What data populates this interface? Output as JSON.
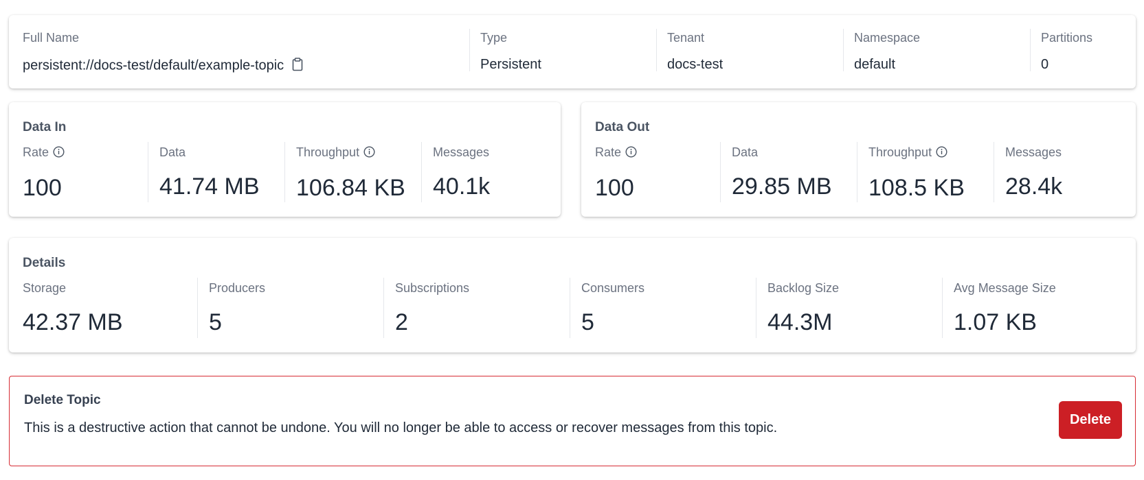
{
  "topic_info": {
    "full_name": {
      "label": "Full Name",
      "value": "persistent://docs-test/default/example-topic"
    },
    "type": {
      "label": "Type",
      "value": "Persistent"
    },
    "tenant": {
      "label": "Tenant",
      "value": "docs-test"
    },
    "namespace": {
      "label": "Namespace",
      "value": "default"
    },
    "partitions": {
      "label": "Partitions",
      "value": "0"
    }
  },
  "data_in": {
    "title": "Data In",
    "rate": {
      "label": "Rate",
      "value": "100"
    },
    "data": {
      "label": "Data",
      "value": "41.74 MB"
    },
    "throughput": {
      "label": "Throughput",
      "value": "106.84 KB"
    },
    "messages": {
      "label": "Messages",
      "value": "40.1k"
    }
  },
  "data_out": {
    "title": "Data Out",
    "rate": {
      "label": "Rate",
      "value": "100"
    },
    "data": {
      "label": "Data",
      "value": "29.85 MB"
    },
    "throughput": {
      "label": "Throughput",
      "value": "108.5 KB"
    },
    "messages": {
      "label": "Messages",
      "value": "28.4k"
    }
  },
  "details": {
    "title": "Details",
    "storage": {
      "label": "Storage",
      "value": "42.37 MB"
    },
    "producers": {
      "label": "Producers",
      "value": "5"
    },
    "subscriptions": {
      "label": "Subscriptions",
      "value": "2"
    },
    "consumers": {
      "label": "Consumers",
      "value": "5"
    },
    "backlog_size": {
      "label": "Backlog Size",
      "value": "44.3M"
    },
    "avg_message_size": {
      "label": "Avg Message Size",
      "value": "1.07 KB"
    }
  },
  "delete_topic": {
    "title": "Delete Topic",
    "description": "This is a destructive action that cannot be undone. You will no longer be able to access or recover messages from this topic.",
    "button_label": "Delete"
  },
  "icons": {
    "copy": "clipboard-icon",
    "info": "info-circle-icon"
  },
  "colors": {
    "danger": "#cc1f25",
    "danger_border": "#d62b33",
    "label": "#6b7280",
    "value": "#1f2937"
  }
}
